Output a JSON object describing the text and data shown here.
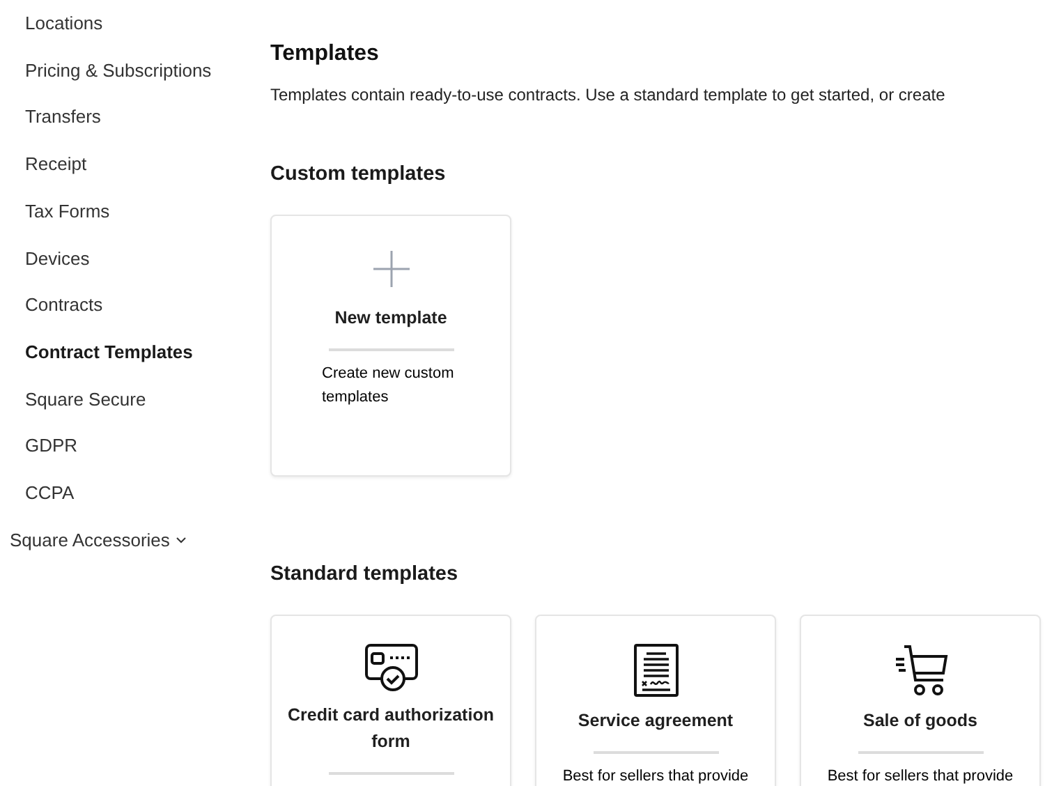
{
  "sidebar": {
    "items": [
      {
        "label": "Locations",
        "selected": false
      },
      {
        "label": "Pricing & Subscriptions",
        "selected": false
      },
      {
        "label": "Transfers",
        "selected": false
      },
      {
        "label": "Receipt",
        "selected": false
      },
      {
        "label": "Tax Forms",
        "selected": false
      },
      {
        "label": "Devices",
        "selected": false
      },
      {
        "label": "Contracts",
        "selected": false
      },
      {
        "label": "Contract Templates",
        "selected": true
      },
      {
        "label": "Square Secure",
        "selected": false
      },
      {
        "label": "GDPR",
        "selected": false
      },
      {
        "label": "CCPA",
        "selected": false
      }
    ],
    "group": {
      "label": "Square Accessories",
      "expanded": false
    }
  },
  "page": {
    "title": "Templates",
    "description": "Templates contain ready-to-use contracts. Use a standard template to get started, or create"
  },
  "custom": {
    "heading": "Custom templates",
    "cards": [
      {
        "kind": "plus",
        "title": "New template",
        "description": "Create new custom templates"
      }
    ]
  },
  "standard": {
    "heading": "Standard templates",
    "cards": [
      {
        "kind": "card",
        "title": "Credit card authorization form"
      },
      {
        "kind": "document",
        "title": "Service agreement",
        "description": "Best for sellers that provide"
      },
      {
        "kind": "cart",
        "title": "Sale of goods",
        "description": "Best for sellers that provide"
      }
    ]
  }
}
